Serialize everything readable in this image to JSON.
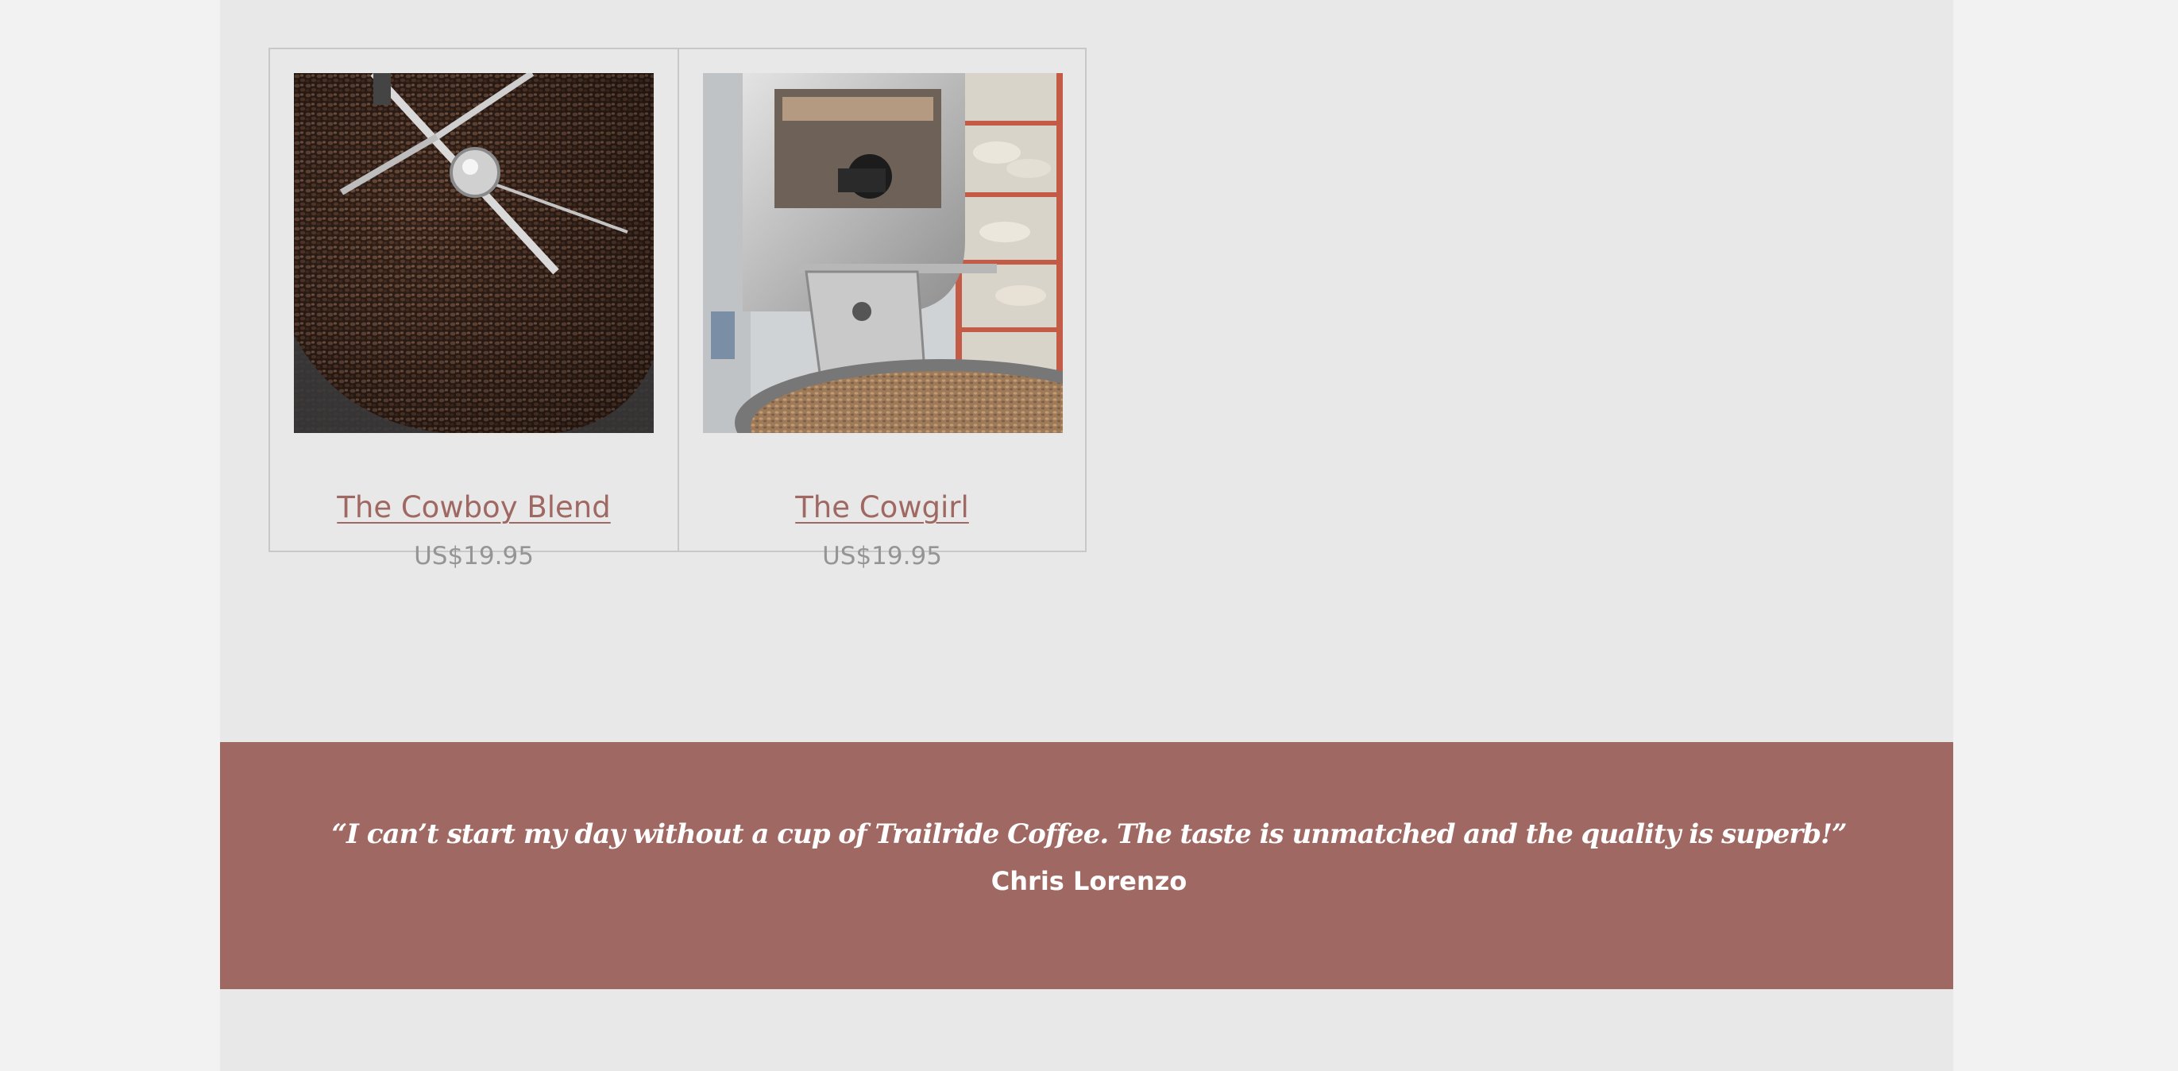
{
  "products": [
    {
      "title": "The Cowboy Blend",
      "price": "US$19.95",
      "image": "roasted-coffee-beans-photo"
    },
    {
      "title": "The Cowgirl",
      "price": "US$19.95",
      "image": "coffee-roaster-machine-photo"
    }
  ],
  "testimonial": {
    "quote": "“I can’t start my day without a cup of Trailride Coffee. The taste is unmatched and the quality is superb!”",
    "author": "Chris Lorenzo"
  },
  "colors": {
    "accent": "#a06862",
    "page_background": "#e8e8e8",
    "outer_background": "#f2f2f2",
    "price_text": "#959595"
  }
}
